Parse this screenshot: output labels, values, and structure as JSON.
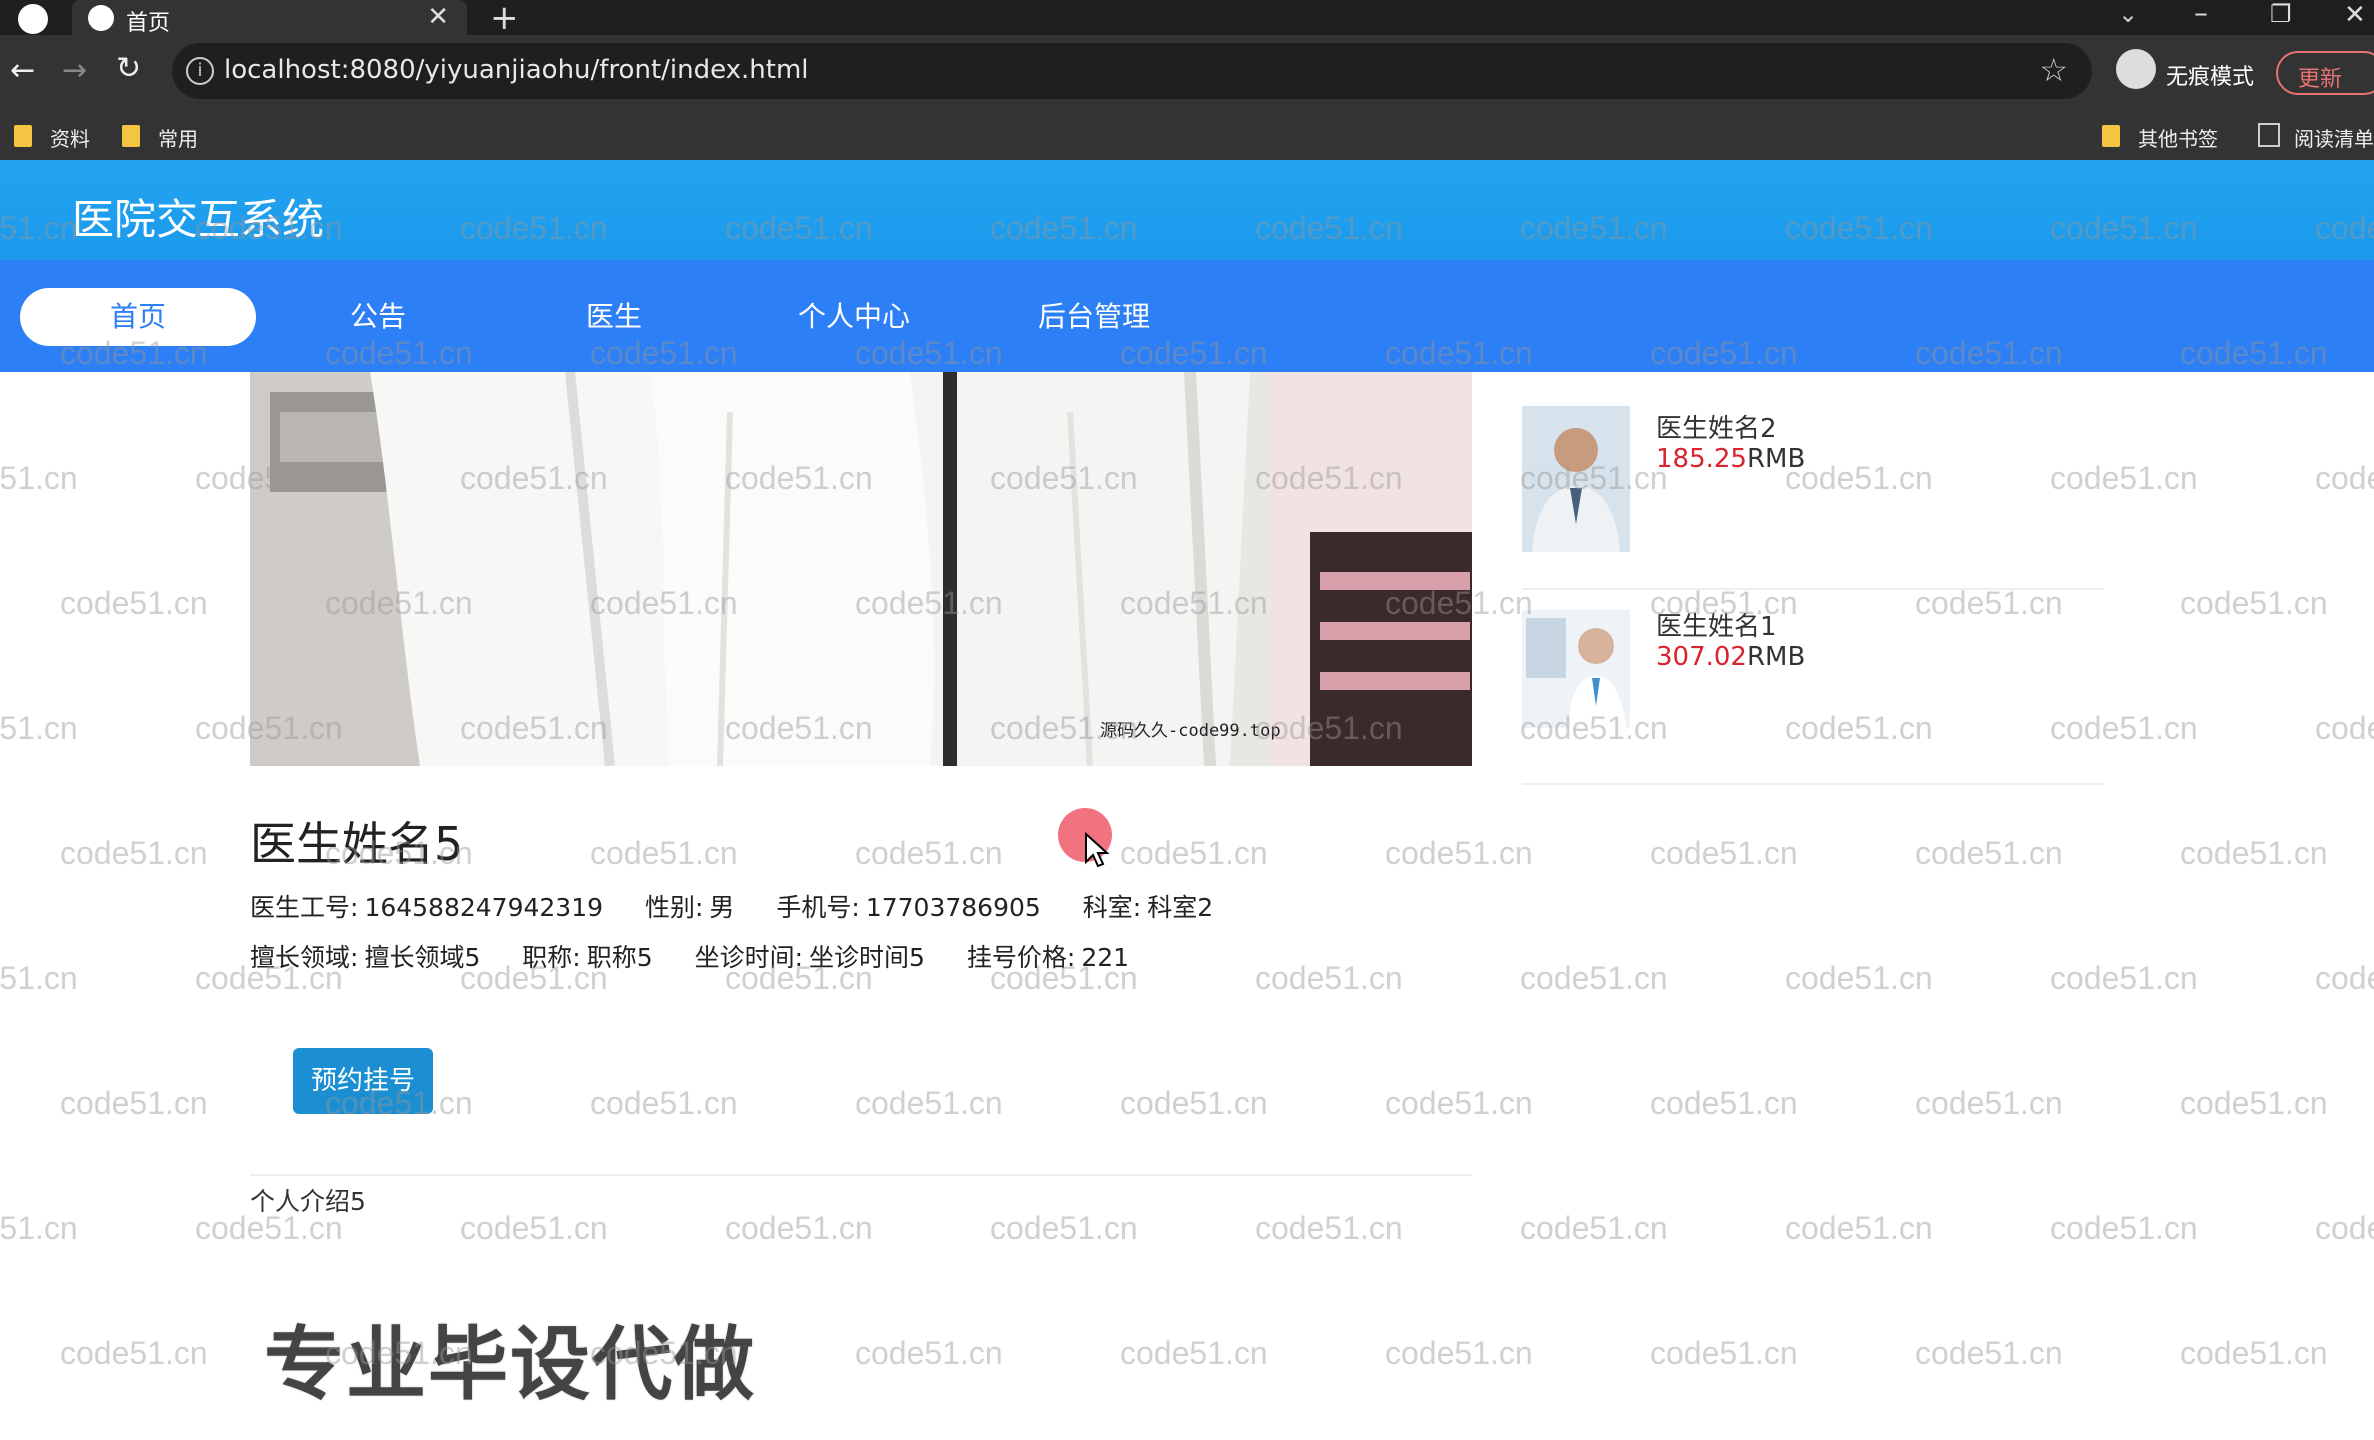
{
  "browser": {
    "tab_title": "首页",
    "url": "localhost:8080/yiyuanjiaohu/front/index.html",
    "incognito_label": "无痕模式",
    "update_label": "更新",
    "bookmarks": [
      "资料",
      "常用"
    ],
    "other_bookmarks": "其他书签",
    "reading_list": "阅读清单"
  },
  "site": {
    "title": "医院交互系统",
    "nav": [
      "首页",
      "公告",
      "医生",
      "个人中心",
      "后台管理"
    ],
    "active_nav": "首页"
  },
  "hero": {
    "caption": "源码久久-code99.top"
  },
  "side_doctors": [
    {
      "name": "医生姓名2",
      "price": "185.25",
      "unit": "RMB"
    },
    {
      "name": "医生姓名1",
      "price": "307.02",
      "unit": "RMB"
    }
  ],
  "doctor": {
    "name": "医生姓名5",
    "id_label": "医生工号:",
    "id_value": "164588247942319",
    "gender_label": "性别:",
    "gender_value": "男",
    "phone_label": "手机号:",
    "phone_value": "17703786905",
    "dept_label": "科室:",
    "dept_value": "科室2",
    "specialty_label": "擅长领域:",
    "specialty_value": "擅长领域5",
    "title_label": "职称:",
    "title_value": "职称5",
    "schedule_label": "坐诊时间:",
    "schedule_value": "坐诊时间5",
    "fee_label": "挂号价格:",
    "fee_value": "221",
    "book_button": "预约挂号",
    "intro": "个人介绍5"
  },
  "promo_text": "专业毕设代做",
  "watermark_text": "code51.cn",
  "colors": {
    "header_blue": "#1a9aec",
    "nav_blue": "#2d7ff5",
    "price_red": "#d9232f",
    "button_blue": "#1b8fd2"
  }
}
